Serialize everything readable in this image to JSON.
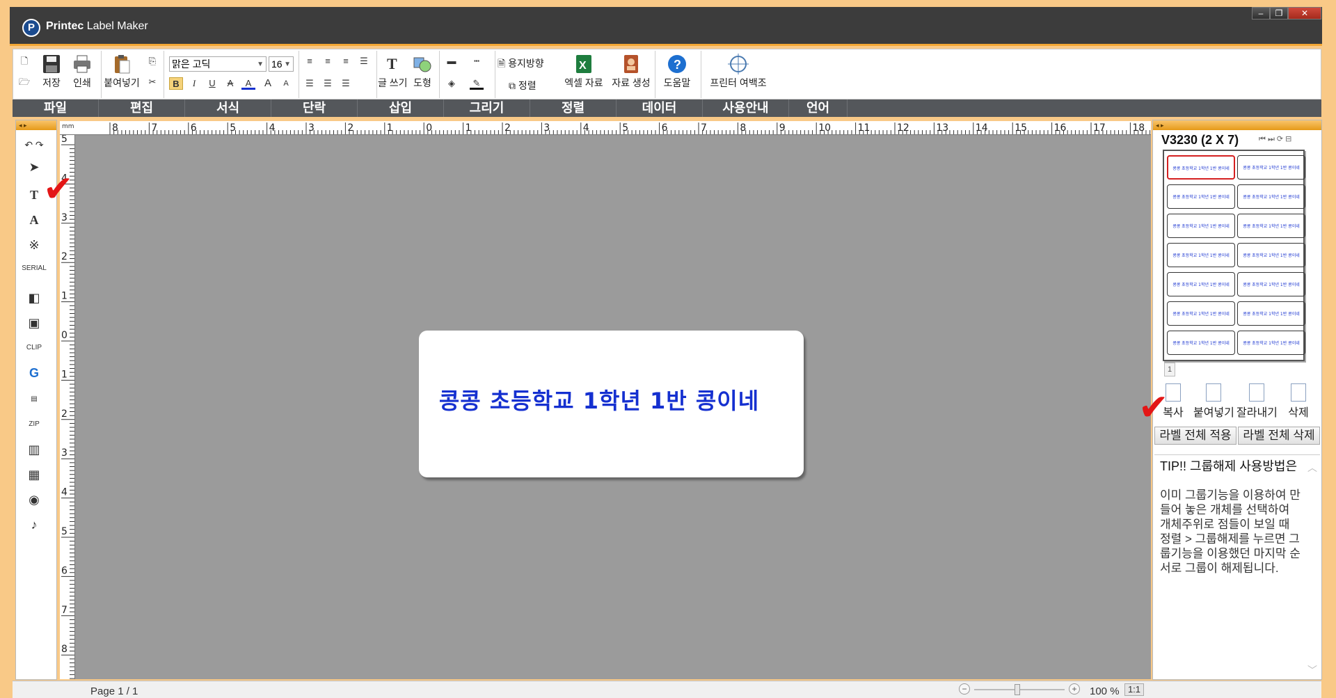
{
  "app": {
    "title_brand": "Printec",
    "title_rest": " Label Maker",
    "logo_letter": "P"
  },
  "window_controls": {
    "minimize": "–",
    "maximize": "❐",
    "close": "✕"
  },
  "ribbon": {
    "save": "저장",
    "print": "인쇄",
    "paste": "붙여넣기",
    "font_name": "맑은 고딕",
    "font_size": "16",
    "bold": "B",
    "italic": "I",
    "underline": "U",
    "strike": "A",
    "font_color": "A",
    "grow": "A",
    "shrink": "A",
    "text_write": "글 쓰기",
    "shape": "도형",
    "paper_direction": "용지방향",
    "align": "정렬",
    "excel": "엑셀 자료",
    "data_gen": "자료 생성",
    "help": "도움말",
    "printer_margin": "프린터 여백조"
  },
  "menu": [
    "파일",
    "편집",
    "서식",
    "단락",
    "삽입",
    "그리기",
    "정렬",
    "데이터",
    "사용안내",
    "언어"
  ],
  "rulers": {
    "unit": "mm",
    "h_labels": [
      "8",
      "7",
      "6",
      "5",
      "4",
      "3",
      "2",
      "1",
      "0",
      "1",
      "2",
      "3",
      "4",
      "5",
      "6",
      "7",
      "8",
      "9",
      "10",
      "11",
      "12",
      "13",
      "14",
      "15",
      "16",
      "17",
      "18"
    ],
    "v_labels": [
      "5",
      "4",
      "3",
      "2",
      "1",
      "0",
      "1",
      "2",
      "3",
      "4",
      "5",
      "6",
      "7",
      "8"
    ]
  },
  "label": {
    "text": "콩콩 초등학교 1학년 1반 콩이네"
  },
  "right_panel": {
    "template_name": "V3230 (2 X 7)",
    "cell_text": "콩콩 초등학교 1학년 1반 콩이네",
    "page_number": "1",
    "copy": "복사",
    "paste": "붙여넣기",
    "cut": "잘라내기",
    "delete": "삭제",
    "apply_all": "라벨 전체 적용",
    "delete_all": "라벨 전체 삭제",
    "tip_title": "TIP!! 그룹해제 사용방법은",
    "tip_body": "이미 그룹기능을 이용하여 만들어 놓은 개체를 선택하여 개체주위로 점들이 보일 때 정렬 > 그룹해제를 누르면 그룹기능을 이용했던 마지막 순서로 그룹이 해제됩니다."
  },
  "status": {
    "page": "Page 1 / 1",
    "zoom": "100 %",
    "fit": "1:1"
  },
  "annotations": {
    "check_mark": "✔"
  },
  "colors": {
    "accent": "#f3a735",
    "label_text": "#1530d0",
    "menu_bg": "#54575b",
    "canvas": "#9b9b9b",
    "check": "#e31616"
  }
}
